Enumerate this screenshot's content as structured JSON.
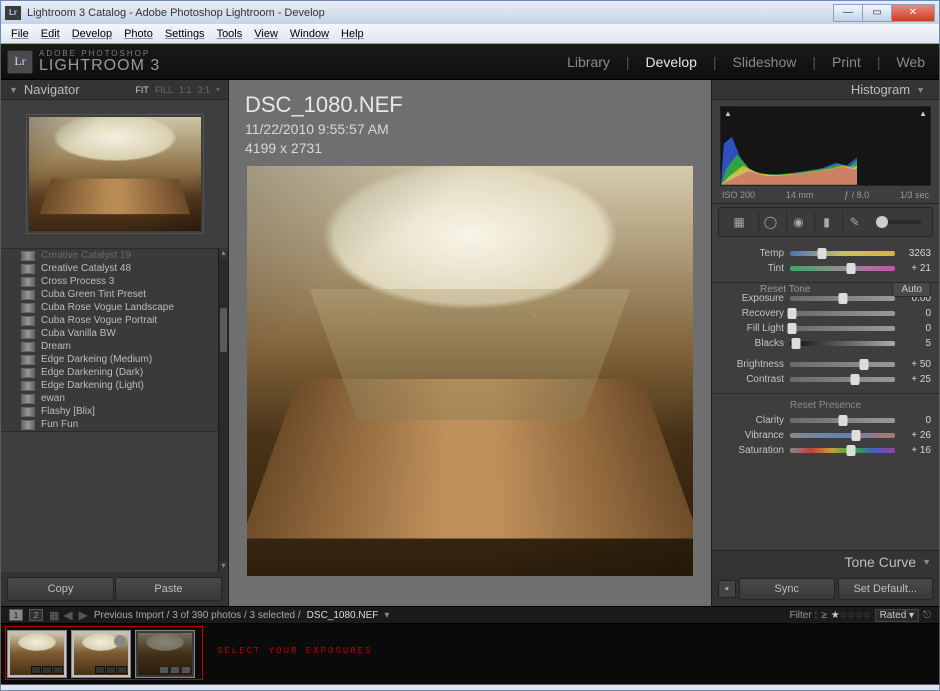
{
  "window": {
    "title": "Lightroom 3 Catalog - Adobe Photoshop Lightroom - Develop"
  },
  "menu": [
    "File",
    "Edit",
    "Develop",
    "Photo",
    "Settings",
    "Tools",
    "View",
    "Window",
    "Help"
  ],
  "brand": {
    "logo": "Lr",
    "line1": "ADOBE PHOTOSHOP",
    "line2": "LIGHTROOM 3"
  },
  "modules": {
    "items": [
      "Library",
      "Develop",
      "Slideshow",
      "Print",
      "Web"
    ],
    "active": "Develop"
  },
  "navigator": {
    "title": "Navigator",
    "fit": "FIT",
    "fill": "FILL",
    "one": "1:1",
    "ratio": "3:1"
  },
  "presets": [
    "Creative Catalyst 19",
    "Creative Catalyst 48",
    "Cross Process 3",
    "Cuba Green Tint Preset",
    "Cuba Rose Vogue Landscape",
    "Cuba Rose Vogue Portrait",
    "Cuba Vanilla BW",
    "Dream",
    "Edge Darkeing (Medium)",
    "Edge Darkening (Dark)",
    "Edge Darkening (Light)",
    "ewan",
    "Flashy [Blix]",
    "Fun Fun"
  ],
  "leftbuttons": {
    "copy": "Copy",
    "paste": "Paste"
  },
  "image": {
    "filename": "DSC_1080.NEF",
    "datetime": "11/22/2010 9:55:57 AM",
    "dims": "4199 x 2731"
  },
  "histogram": {
    "iso": "ISO 200",
    "focal": "14 mm",
    "fstop": "ƒ / 8.0",
    "shutter": "1/3 sec",
    "title": "Histogram"
  },
  "wb": {
    "temp_label": "Temp",
    "temp_val": "3263",
    "tint_label": "Tint",
    "tint_val": "+ 21"
  },
  "tone": {
    "reset": "Reset Tone",
    "auto": "Auto",
    "exposure": {
      "l": "Exposure",
      "v": "0.00"
    },
    "recovery": {
      "l": "Recovery",
      "v": "0"
    },
    "fill": {
      "l": "Fill Light",
      "v": "0"
    },
    "blacks": {
      "l": "Blacks",
      "v": "5"
    },
    "brightness": {
      "l": "Brightness",
      "v": "+ 50"
    },
    "contrast": {
      "l": "Contrast",
      "v": "+ 25"
    }
  },
  "presence": {
    "reset": "Reset Presence",
    "clarity": {
      "l": "Clarity",
      "v": "0"
    },
    "vibrance": {
      "l": "Vibrance",
      "v": "+ 26"
    },
    "saturation": {
      "l": "Saturation",
      "v": "+ 16"
    }
  },
  "tone_curve": "Tone Curve",
  "rightbuttons": {
    "sync": "Sync",
    "default": "Set Default..."
  },
  "filmstrip": {
    "page1": "1",
    "page2": "2",
    "path": "Previous Import / 3 of 390 photos / 3 selected / ",
    "current": "DSC_1080.NEF",
    "filter_label": "Filter :",
    "ge": "≥",
    "rated": "Rated"
  },
  "annotation": "SELECT YOUR EXPOSURES"
}
